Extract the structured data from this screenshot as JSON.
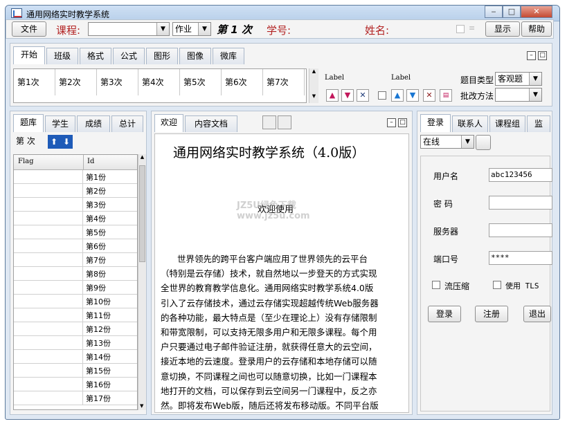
{
  "window": {
    "title": "通用网络实时教学系统"
  },
  "toolbar": {
    "file_label": "文件",
    "course_label": "课程:",
    "course_value": "",
    "type_value": "作业",
    "session_label": "第 1 次",
    "student_id_label": "学号:",
    "name_label": "姓名:",
    "show_label": "显示",
    "help_label": "帮助"
  },
  "ribbon": {
    "tabs": [
      "开始",
      "班级",
      "格式",
      "公式",
      "图形",
      "图像",
      "微库"
    ],
    "sessions": [
      "第1次",
      "第2次",
      "第3次",
      "第4次",
      "第5次",
      "第6次",
      "第7次"
    ],
    "label1": "Label",
    "label2": "Label",
    "question_type_label": "题目类型",
    "question_type_value": "客观题",
    "grading_label": "批改方法",
    "grading_value": ""
  },
  "left": {
    "tabs": [
      "题库",
      "学生",
      "成绩",
      "总计"
    ],
    "session_label": "第  次",
    "columns": [
      "Flag",
      "Id"
    ],
    "rows": [
      "第1份",
      "第2份",
      "第3份",
      "第4份",
      "第5份",
      "第6份",
      "第7份",
      "第8份",
      "第9份",
      "第10份",
      "第11份",
      "第12份",
      "第13份",
      "第14份",
      "第15份",
      "第16份",
      "第17份"
    ]
  },
  "center": {
    "tabs": [
      "欢迎",
      "内容文档"
    ],
    "heading": "通用网络实时教学系统（4.0版）",
    "welcome": "欢迎使用",
    "watermark": "JZ5U绿色下载 www.jz5u.com",
    "lines": [
      "世界领先的跨平台客户端应用了世界领先的云平台",
      "（特别是云存储）技术，就自然地以一步登天的方式实现",
      "全世界的教育教学信息化。通用网络实时教学系统4.0版",
      "引入了云存储技术，通过云存储实现超越传统Web服务器",
      "的各种功能，最大特点是（至少在理论上）没有存储限制",
      "和带宽限制，可以支持无限多用户和无限多课程。每个用",
      "户只要通过电子邮件验证注册，就获得任意大的云空间，",
      "接近本地的云速度。登录用户的云存储和本地存储可以随",
      "意切换，不同课程之间也可以随意切换，比如一门课程本",
      "地打开的文档，可以保存到云空间另一门课程中，反之亦",
      "然。即将发布Web版，随后还将发布移动版。不同平台版"
    ]
  },
  "right": {
    "tabs": [
      "登录",
      "联系人",
      "课程组",
      "监"
    ],
    "status_value": "在线",
    "username_label": "用户名",
    "username_value": "abc123456",
    "password_label": "密  码",
    "server_label": "服务器",
    "port_label": "端口号",
    "port_value": "****",
    "compress_label": "流压缩",
    "tls_label": "使用 TLS",
    "login_label": "登录",
    "register_label": "注册",
    "exit_label": "退出"
  }
}
